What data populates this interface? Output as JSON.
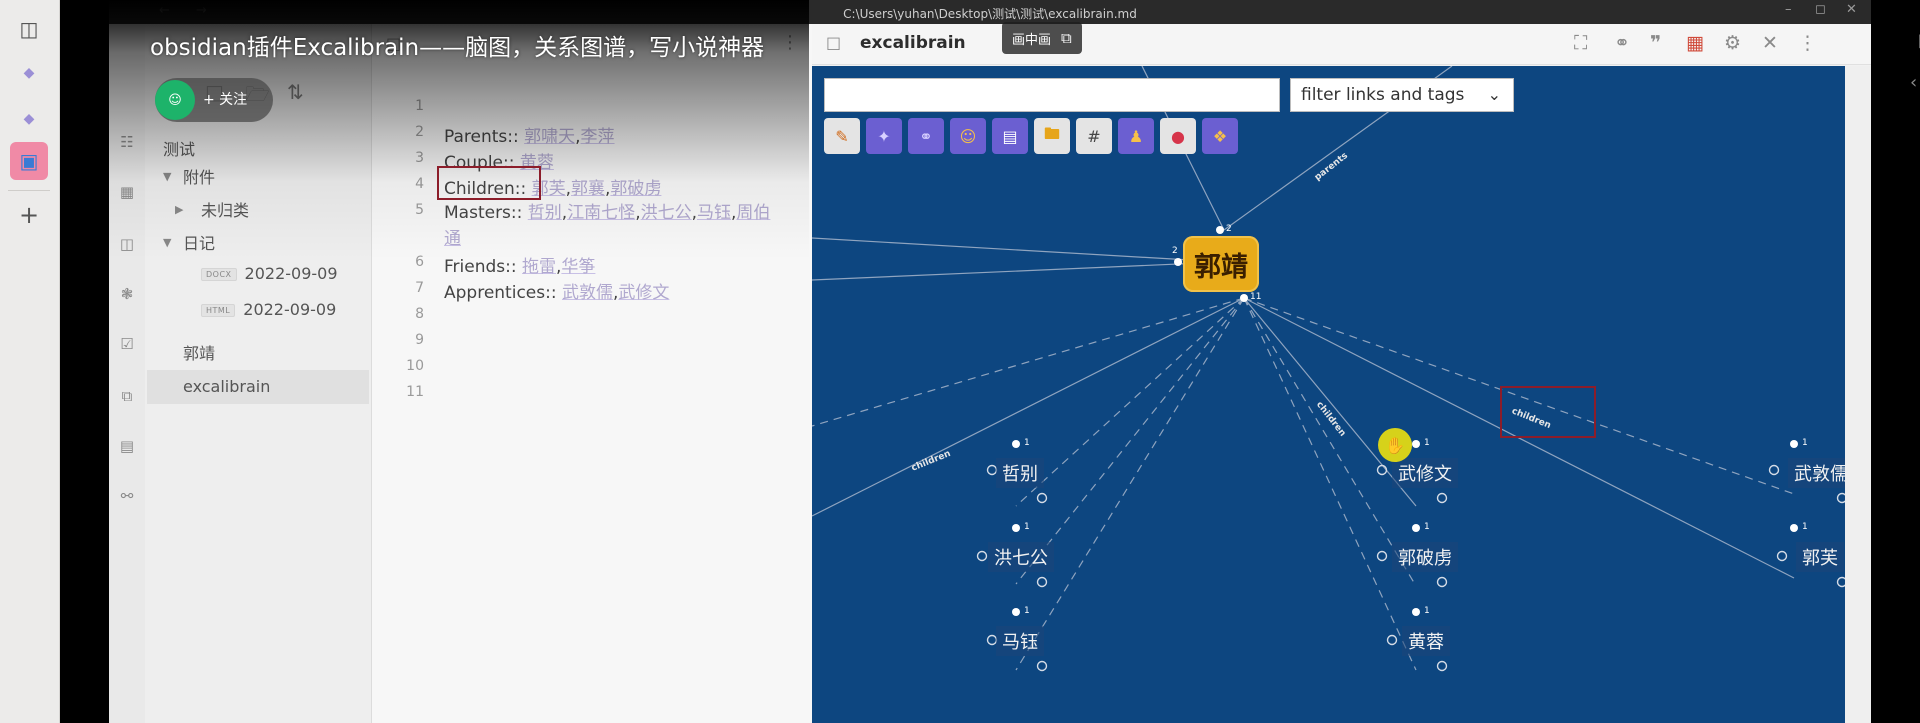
{
  "window": {
    "path": "C:\\Users\\yuhan\\Desktop\\测试\\测试\\excalibrain.md"
  },
  "video": {
    "title": "obsidian插件Excalibrain——脑图，关系图谱，写小说神器",
    "pip_label": "画中画",
    "follow_label": "+ 关注"
  },
  "explorer": {
    "items": [
      {
        "label": "测试"
      },
      {
        "label": "附件"
      },
      {
        "label": "未归类"
      },
      {
        "label": "日记"
      },
      {
        "label": "2022-09-09",
        "badge": "DOCX"
      },
      {
        "label": "2022-09-09",
        "badge": "HTML"
      },
      {
        "label": "郭靖"
      },
      {
        "label": "excalibrain"
      }
    ]
  },
  "editor": {
    "line_numbers": [
      "1",
      "2",
      "3",
      "4",
      "5",
      "",
      "6",
      "7",
      "8",
      "9",
      "10",
      "11"
    ],
    "lines": [
      {
        "key": "Parents::",
        "links": [
          "郭啸天",
          "李萍"
        ]
      },
      {
        "key": "Couple::",
        "links": [
          "黄蓉"
        ]
      },
      {
        "key": "Children::",
        "links": [
          "郭芙",
          "郭襄",
          "郭破虏"
        ]
      },
      {
        "key": "Masters::",
        "links": [
          "哲别",
          "江南七怪",
          "洪七公",
          "马钰",
          "周伯通"
        ]
      },
      {
        "key": "Friends::",
        "links": [
          "拖雷",
          "华筝"
        ]
      },
      {
        "key": "Apprentices::",
        "links": [
          "武敦儒",
          "武修文"
        ]
      }
    ]
  },
  "graph": {
    "tab_title": "excalibrain",
    "search_placeholder": "",
    "filter_label": "filter links and tags",
    "center_node": "郭靖",
    "nodes": [
      "哲别",
      "洪七公",
      "马钰",
      "武修文",
      "郭破虏",
      "黄蓉",
      "武敦儒",
      "郭芙"
    ],
    "edge_labels": {
      "parents": "parents",
      "children": "children",
      "children_left": "children",
      "children_box": "children"
    },
    "counts": {
      "center_top": "2",
      "center_left": "2",
      "center_bottom": "11",
      "child": "1"
    },
    "toolbar_icons": [
      "pencil-icon",
      "wand-icon",
      "link-icon",
      "smile-icon",
      "page-icon",
      "folder-icon",
      "hash-icon",
      "group-icon",
      "pin-icon",
      "puzzle-icon"
    ]
  },
  "colors": {
    "canvas_bg": "#0d4680",
    "center_node": "#e8ab1a",
    "highlight_box": "#8c1d2a",
    "cursor_dot": "#d6d21a",
    "avatar": "#1db36a"
  }
}
